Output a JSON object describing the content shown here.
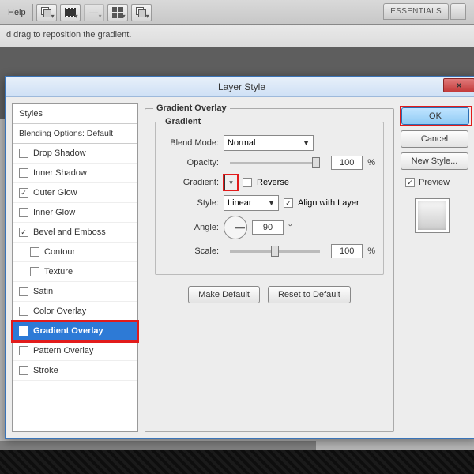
{
  "app": {
    "help_menu": "Help",
    "essentials": "ESSENTIALS",
    "hint": "d drag to reposition the gradient."
  },
  "dialog": {
    "title": "Layer Style",
    "close": "×"
  },
  "styles": {
    "header": "Styles",
    "blending": "Blending Options: Default",
    "items": [
      {
        "label": "Drop Shadow",
        "checked": false
      },
      {
        "label": "Inner Shadow",
        "checked": false
      },
      {
        "label": "Outer Glow",
        "checked": true
      },
      {
        "label": "Inner Glow",
        "checked": false
      },
      {
        "label": "Bevel and Emboss",
        "checked": true
      },
      {
        "label": "Contour",
        "checked": false,
        "indent": true
      },
      {
        "label": "Texture",
        "checked": false,
        "indent": true
      },
      {
        "label": "Satin",
        "checked": false
      },
      {
        "label": "Color Overlay",
        "checked": false
      },
      {
        "label": "Gradient Overlay",
        "checked": true,
        "selected": true
      },
      {
        "label": "Pattern Overlay",
        "checked": false
      },
      {
        "label": "Stroke",
        "checked": false
      }
    ]
  },
  "panel": {
    "group_title": "Gradient Overlay",
    "inner_title": "Gradient",
    "blend_label": "Blend Mode:",
    "blend_value": "Normal",
    "opacity_label": "Opacity:",
    "opacity_value": "100",
    "pct": "%",
    "gradient_label": "Gradient:",
    "reverse": "Reverse",
    "style_label": "Style:",
    "style_value": "Linear",
    "align": "Align with Layer",
    "angle_label": "Angle:",
    "angle_value": "90",
    "deg": "°",
    "scale_label": "Scale:",
    "scale_value": "100",
    "make_default": "Make Default",
    "reset_default": "Reset to Default"
  },
  "right": {
    "ok": "OK",
    "cancel": "Cancel",
    "new_style": "New Style...",
    "preview": "Preview"
  }
}
